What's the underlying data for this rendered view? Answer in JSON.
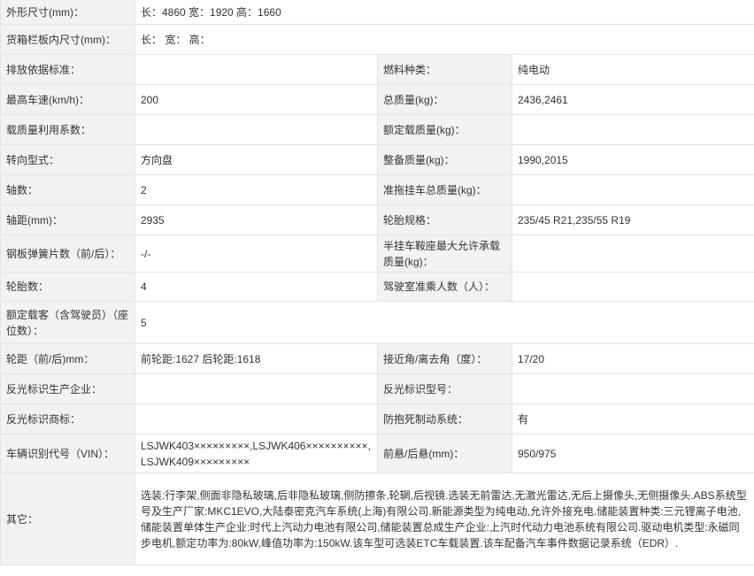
{
  "rows": [
    {
      "l1": "外形尺寸(mm)：",
      "v1": "长：4860 宽：1920 高：1660"
    },
    {
      "l1": "货箱栏板内尺寸(mm)：",
      "v1": "长： 宽： 高："
    },
    {
      "l1": "排放依据标准：",
      "v1": "",
      "l2": "燃料种类：",
      "v2": "纯电动"
    },
    {
      "l1": "最高车速(km/h)：",
      "v1": "200",
      "l2": "总质量(kg)：",
      "v2": "2436,2461"
    },
    {
      "l1": "载质量利用系数：",
      "v1": "",
      "l2": "额定载质量(kg)：",
      "v2": ""
    },
    {
      "l1": "转向型式：",
      "v1": "方向盘",
      "l2": "整备质量(kg)：",
      "v2": "1990,2015"
    },
    {
      "l1": "轴数：",
      "v1": "2",
      "l2": "准拖挂车总质量(kg)：",
      "v2": ""
    },
    {
      "l1": "轴距(mm)：",
      "v1": "2935",
      "l2": "轮胎规格：",
      "v2": "235/45 R21,235/55 R19"
    },
    {
      "l1": "钢板弹簧片数（前/后）：",
      "v1": "-/-",
      "l2": "半挂车鞍座最大允许承载质量(kg)：",
      "v2": ""
    },
    {
      "l1": "轮胎数：",
      "v1": "4",
      "l2": "驾驶室准乘人数（人）：",
      "v2": ""
    },
    {
      "l1": "额定载客（含驾驶员）（座位数）：",
      "v1": "5"
    },
    {
      "l1": "轮距（前/后)mm：",
      "v1": "前轮距:1627 后轮距:1618",
      "l2": "接近角/离去角（度）：",
      "v2": "17/20"
    },
    {
      "l1": "反光标识生产企业：",
      "v1": "",
      "l2": "反光标识型号：",
      "v2": ""
    },
    {
      "l1": "反光标识商标：",
      "v1": "",
      "l2": "防抱死制动系统：",
      "v2": "有"
    },
    {
      "l1": "车辆识别代号（VIN）：",
      "v1": "LSJWK403×××××××××,LSJWK406××××××××××,LSJWK409×××××××××",
      "l2": "前悬/后悬(mm)：",
      "v2": "950/975"
    },
    {
      "l1": "其它：",
      "v1": "选装:行李架,侧面非隐私玻璃,后非隐私玻璃,侧防擦条,轮辋,后视镜.选装无前雷达,无激光雷达,无后上摄像头,无侧摄像头.ABS系统型号及生产厂家:MKC1EVO,大陆泰密克汽车系统(上海)有限公司.新能源类型为纯电动,允许外接充电.储能装置种类:三元锂离子电池,储能装置单体生产企业:时代上汽动力电池有限公司,储能装置总成生产企业:上汽时代动力电池系统有限公司.驱动电机类型:永磁同步电机,额定功率为:80kW,峰值功率为:150kW.该车型可选装ETC车载装置.该车配备汽车事件数据记录系统（EDR）."
    }
  ]
}
